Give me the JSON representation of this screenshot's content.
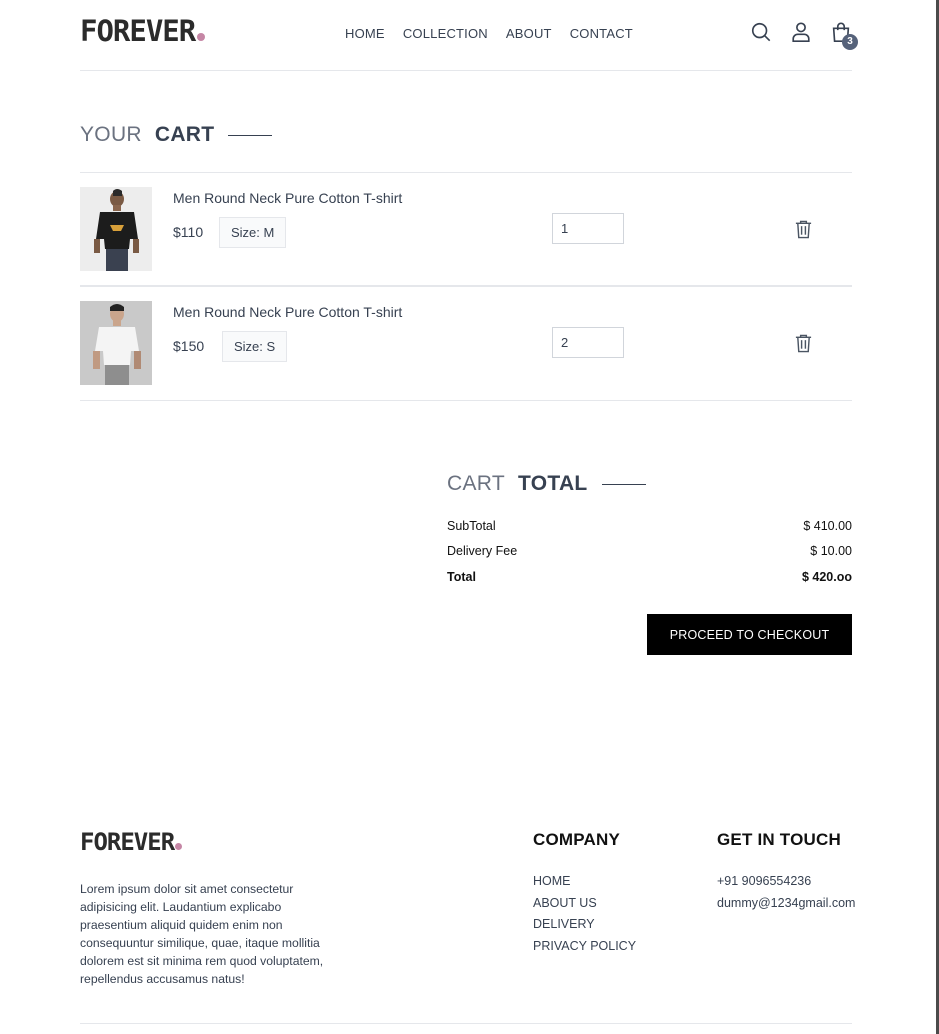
{
  "brand": {
    "name": "FOREVER",
    "dot_color": "#c586a5"
  },
  "nav": {
    "items": [
      "HOME",
      "COLLECTION",
      "ABOUT",
      "CONTACT"
    ]
  },
  "header_icons": {
    "search": "search-icon",
    "profile": "user-icon",
    "cart": "shopping-bag-icon",
    "cart_count": "3"
  },
  "cart": {
    "title_light": "YOUR",
    "title_bold": "CART",
    "items": [
      {
        "name": "Men Round Neck Pure Cotton T-shirt",
        "price": "$110",
        "size": "Size: M",
        "quantity": "1",
        "image": "black-tshirt-photo",
        "remove_icon": "trash-icon"
      },
      {
        "name": "Men Round Neck Pure Cotton T-shirt",
        "price": "$150",
        "size": "Size: S",
        "quantity": "2",
        "image": "white-tshirt-photo",
        "remove_icon": "trash-icon"
      }
    ]
  },
  "totals": {
    "title_light": "CART",
    "title_bold": "TOTAL",
    "subtotal_label": "SubTotal",
    "subtotal_value": "$ 410.00",
    "delivery_label": "Delivery Fee",
    "delivery_value": "$ 10.00",
    "total_label": "Total",
    "total_value": "$ 420.oo",
    "checkout_label": "PROCEED TO CHECKOUT"
  },
  "footer": {
    "logo": "FOREVER",
    "description": "Lorem ipsum dolor sit amet consectetur adipisicing elit. Laudantium explicabo praesentium aliquid quidem enim non consequuntur similique, quae, itaque mollitia dolorem est sit minima rem quod voluptatem, repellendus accusamus natus!",
    "company_title": "COMPANY",
    "company_links": [
      "HOME",
      "ABOUT US",
      "DELIVERY",
      "PRIVACY POLICY"
    ],
    "contact_title": "GET IN TOUCH",
    "phone": "+91 9096554236",
    "email": "dummy@1234gmail.com"
  }
}
